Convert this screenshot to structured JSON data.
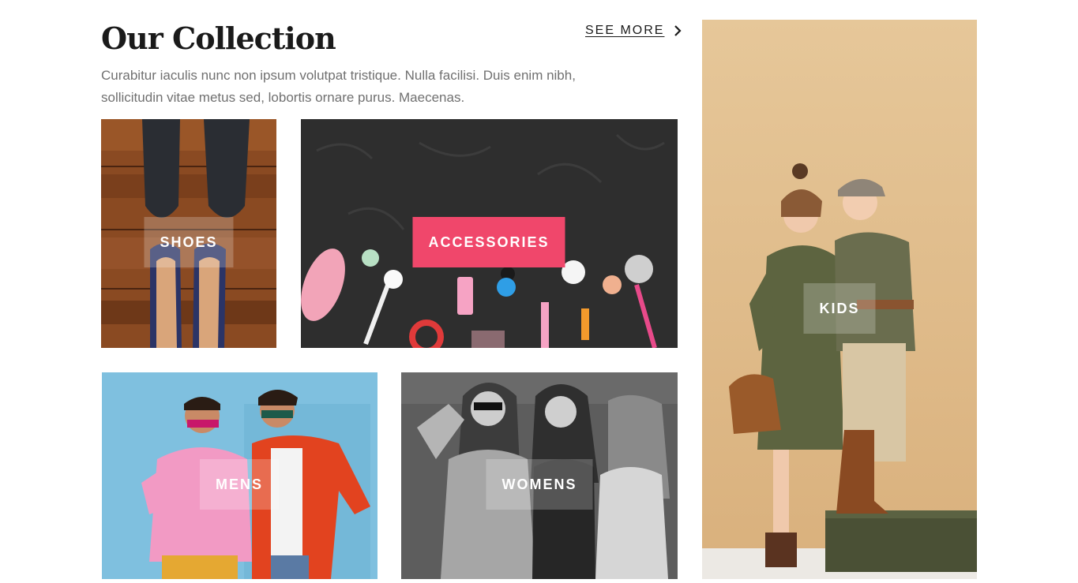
{
  "section": {
    "title": "Our Collection",
    "see_more": "SEE MORE",
    "description": "Curabitur iaculis nunc non ipsum volutpat tristique. Nulla facilisi. Duis enim nibh, sollicitudin vitae metus sed, lobortis ornare purus. Maecenas."
  },
  "categories": [
    {
      "label": "SHOES"
    },
    {
      "label": "ACCESSORIES"
    },
    {
      "label": "MENS"
    },
    {
      "label": "WOMENS"
    },
    {
      "label": "KIDS"
    }
  ],
  "colors": {
    "accent": "#f0476b",
    "heading": "#1a1a1a",
    "body_text": "#707070"
  }
}
